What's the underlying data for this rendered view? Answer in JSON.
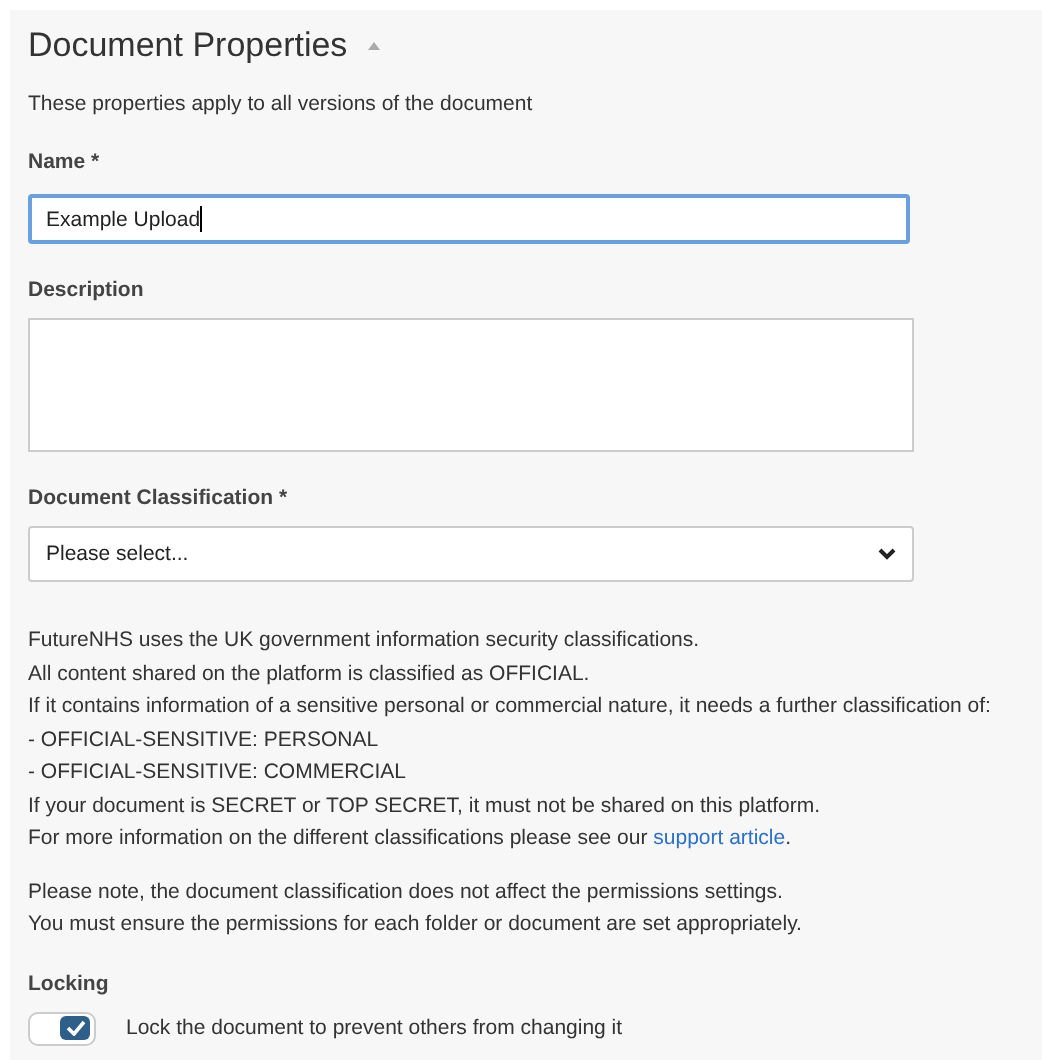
{
  "section": {
    "title": "Document Properties",
    "expanded": true,
    "intro": "These properties apply to all versions of the document"
  },
  "fields": [
    {
      "kind": "text",
      "label": "Name *",
      "value": "Example Upload",
      "focused": true
    },
    {
      "kind": "textarea",
      "label": "Description",
      "focused": false
    },
    {
      "kind": "select",
      "label": "Document Classification *",
      "value": "Please select...",
      "focused": false
    }
  ],
  "info_lines": [
    {
      "text": "FutureNHS uses the UK government information security classifications."
    },
    {
      "text": "All content shared on the platform is classified as OFFICIAL."
    },
    {
      "text": "If it contains information of a sensitive personal or commercial nature, it needs a further classification of:"
    },
    {
      "text": "- OFFICIAL-SENSITIVE: PERSONAL"
    },
    {
      "text": "- OFFICIAL-SENSITIVE: COMMERCIAL"
    },
    {
      "text": "If your document is SECRET or TOP SECRET, it must not be shared on this platform."
    },
    {
      "text": "For more information on the different classifications please see our ",
      "link": "support article",
      "after": "."
    }
  ],
  "note_lines": [
    "Please note, the document classification does not affect the permissions settings.",
    "You must ensure the permissions for each folder or document are set appropriately."
  ],
  "locking": {
    "label": "Locking",
    "toggle_label": "Lock the document to prevent others from changing it",
    "on": true
  }
}
